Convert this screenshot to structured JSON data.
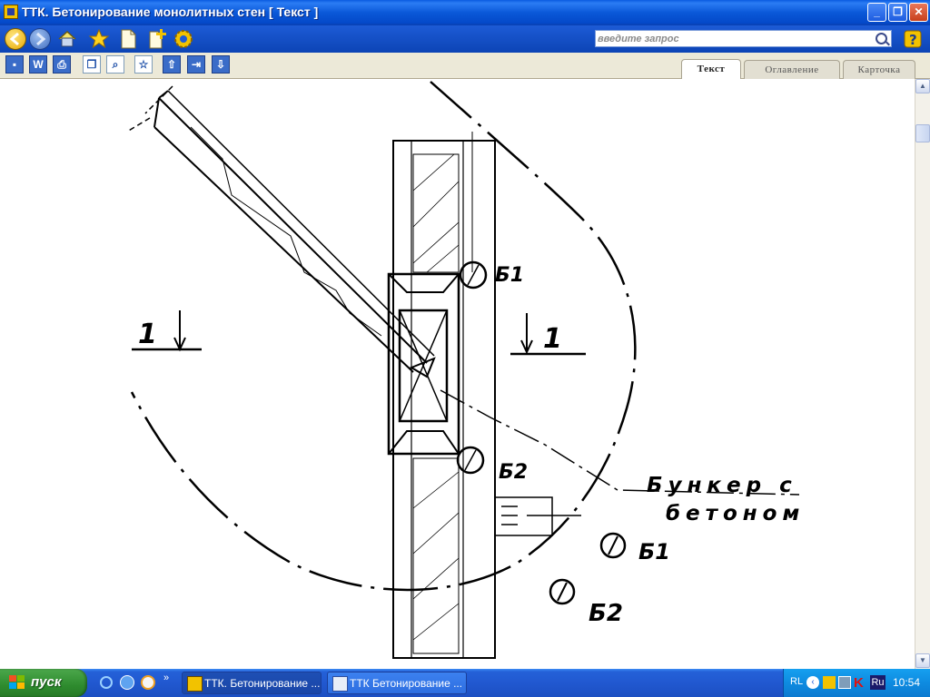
{
  "window": {
    "title": "ТТК. Бетонирование монолитных стен [ Текст ]",
    "controls": {
      "minimize": "_",
      "maximize": "❐",
      "close": "✕"
    }
  },
  "search": {
    "placeholder": "введите запрос"
  },
  "tabs": [
    {
      "label": "Текст",
      "active": true
    },
    {
      "label": "Оглавление",
      "active": false
    },
    {
      "label": "Карточка",
      "active": false
    }
  ],
  "drawing": {
    "section_left": "1",
    "section_right": "1",
    "label_b1": "Б1",
    "label_b2": "Б2",
    "bunker_line1": "Бункер с",
    "bunker_line2": "бетоном",
    "legend_b1": "Б1",
    "legend_b2": "Б2"
  },
  "taskbar": {
    "start_label": "пуск",
    "tasks": [
      {
        "label": "ТТК. Бетонирование ..."
      },
      {
        "label": "ТТК Бетонирование ..."
      }
    ],
    "tray_language": "RL",
    "tray_lang_badge": "Ru",
    "clock": "10:54",
    "show_more": "»"
  },
  "colors": {
    "titlebar": "#0a58d8",
    "taskbar": "#2158d0",
    "start": "#2e8b2e",
    "tray": "#0e8be0"
  }
}
